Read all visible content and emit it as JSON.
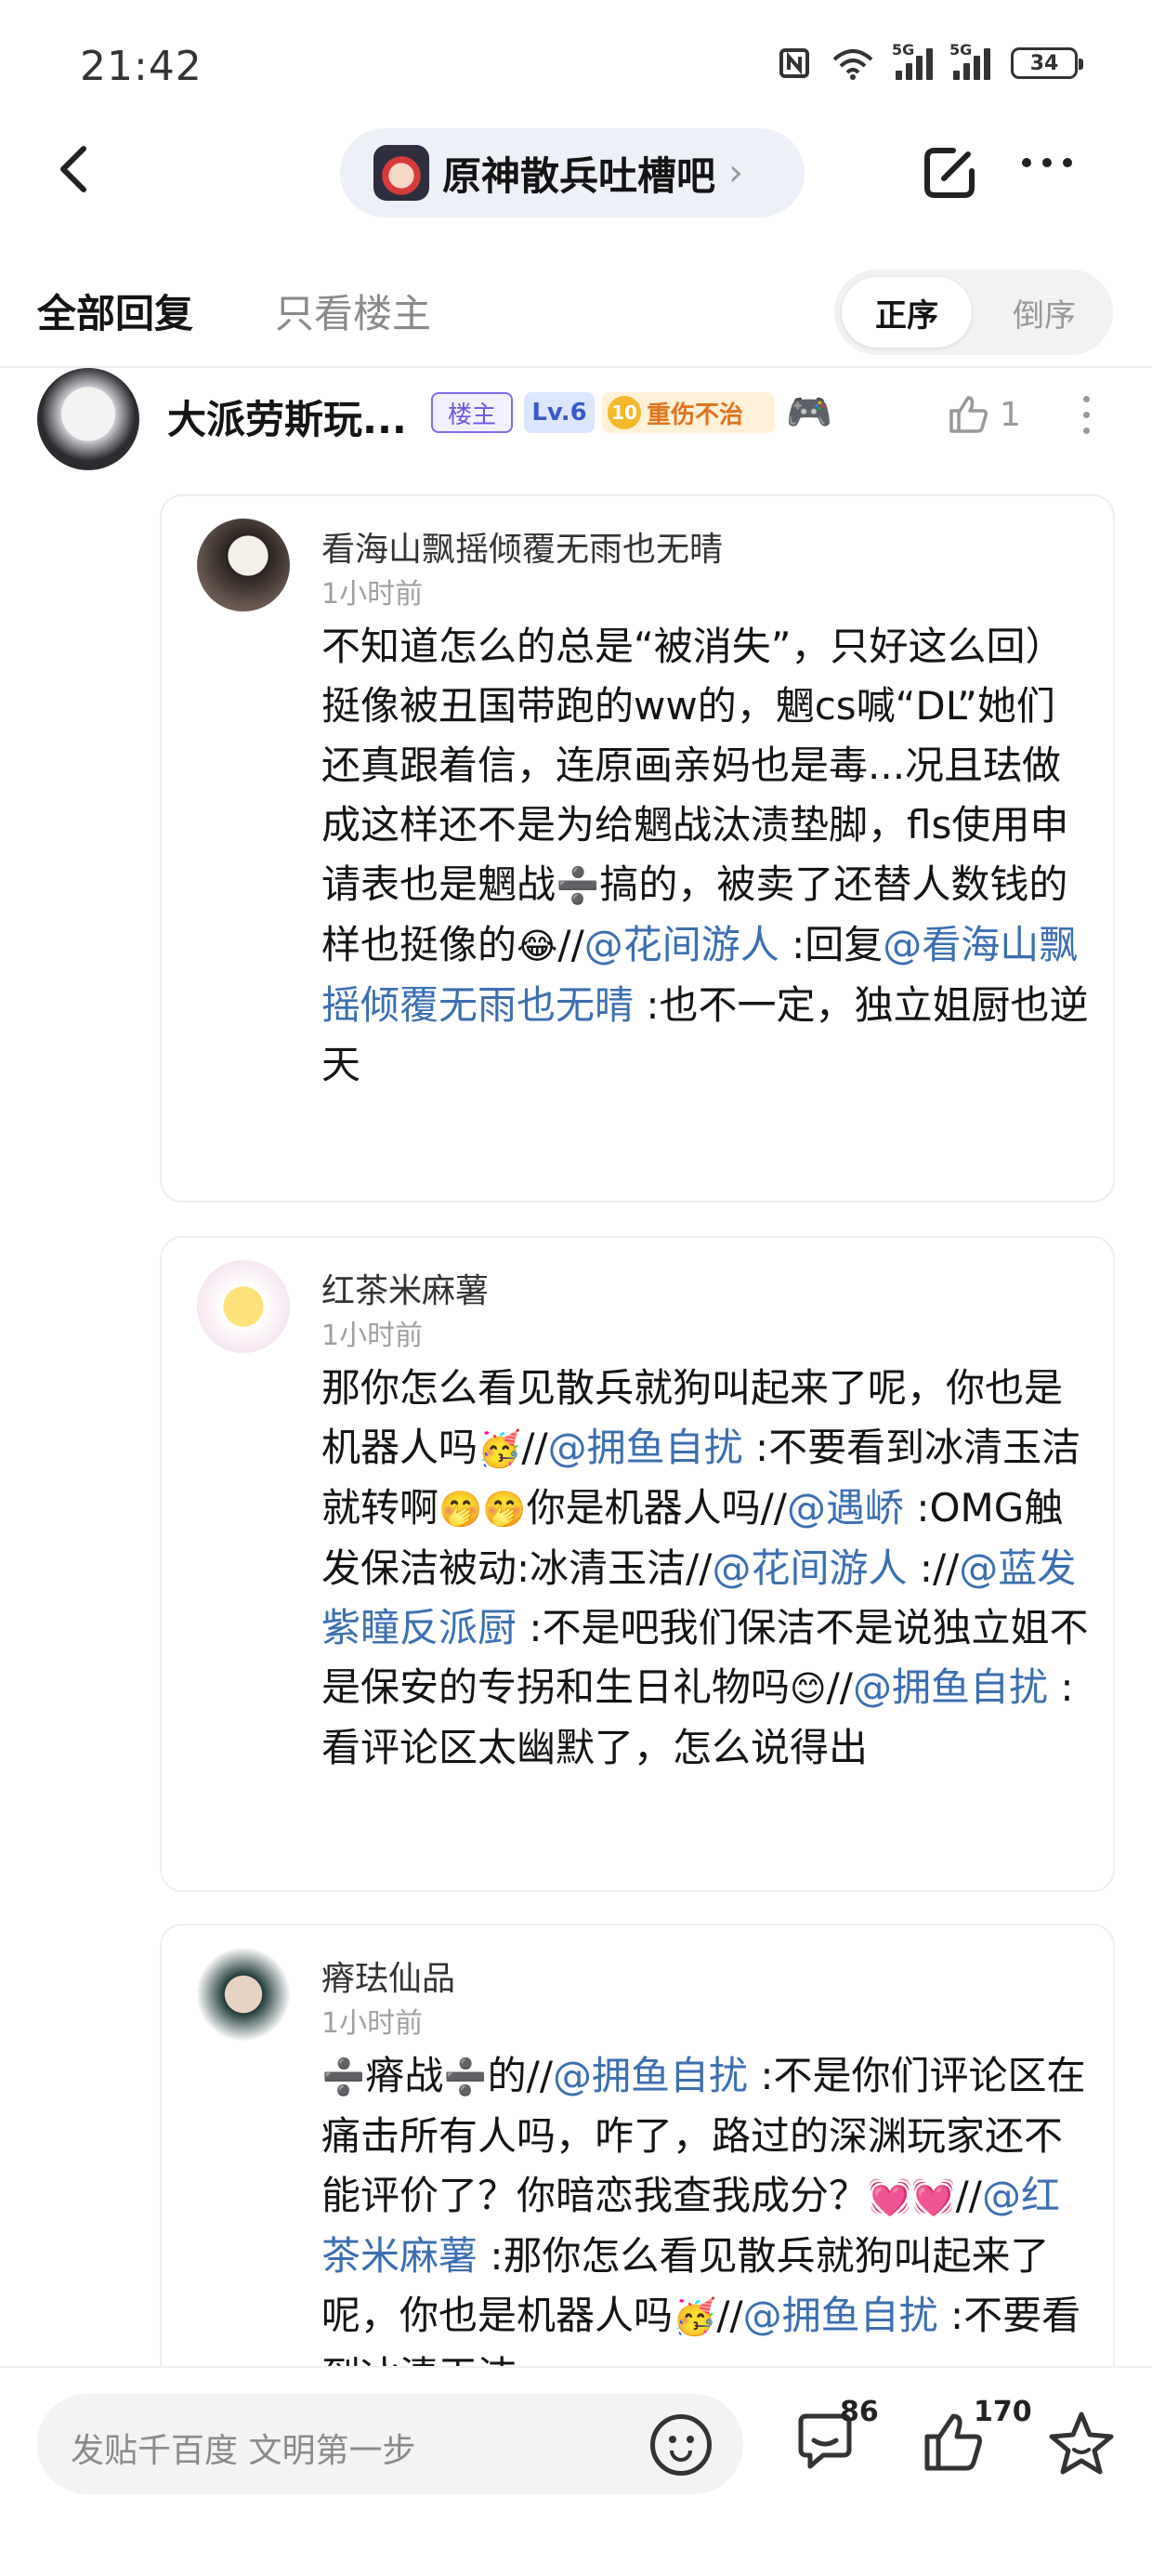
{
  "status_bar": {
    "time": "21:42",
    "network_a": "5G",
    "network_b": "5G",
    "battery": "34"
  },
  "nav": {
    "forum_name": "原神散兵吐槽吧",
    "chevron": "›"
  },
  "tabs": {
    "all_replies": "全部回复",
    "only_op": "只看楼主",
    "order_asc": "正序",
    "order_desc": "倒序"
  },
  "op": {
    "name": "大派劳斯玩...",
    "badge_host": "楼主",
    "badge_level": "Lv.6",
    "medal_number": "10",
    "badge_title": "重伤不治",
    "emoji": "🎮",
    "like_count": "1"
  },
  "comments": [
    {
      "name": "看海山飘摇倾覆无雨也无晴",
      "time": "1小时前",
      "segments": [
        {
          "t": "不知道怎么的总是“被消失”，只好这么回）挺像被丑国带跑的ww的，魍cs喊“DL”她们还真跟着信，连原画亲妈也是毒...况且珐做成这样还不是为给魍战汰渍垫脚，fls使用申请表也是魍战"
        },
        {
          "t": "➗",
          "emo": true
        },
        {
          "t": "搞的，被卖了还替人数钱的样也挺像的"
        },
        {
          "t": "😂",
          "emo": true
        },
        {
          "t": "//"
        },
        {
          "t": "@花间游人",
          "m": true
        },
        {
          "t": " :回复"
        },
        {
          "t": "@看海山飘摇倾覆无雨也无晴",
          "m": true
        },
        {
          "t": " :也不一定，独立姐厨也逆天"
        }
      ]
    },
    {
      "name": "红茶米麻薯",
      "time": "1小时前",
      "segments": [
        {
          "t": "那你怎么看见散兵就狗叫起来了呢，你也是机器人吗"
        },
        {
          "t": "🥳",
          "emo": true
        },
        {
          "t": "//"
        },
        {
          "t": "@拥鱼自扰",
          "m": true
        },
        {
          "t": " :不要看到冰清玉洁就转啊"
        },
        {
          "t": "🤭🤭",
          "emo": true
        },
        {
          "t": "你是机器人吗//"
        },
        {
          "t": "@遇峤",
          "m": true
        },
        {
          "t": " :OMG触发保洁被动:冰清玉洁//"
        },
        {
          "t": "@花间游人",
          "m": true
        },
        {
          "t": " ://"
        },
        {
          "t": "@蓝发紫瞳反派厨",
          "m": true
        },
        {
          "t": " :不是吧我们保洁不是说独立姐不是保安的专拐和生日礼物吗"
        },
        {
          "t": "😊",
          "emo": true
        },
        {
          "t": "//"
        },
        {
          "t": "@拥鱼自扰",
          "m": true
        },
        {
          "t": " :看评论区太幽默了，怎么说得出"
        }
      ]
    },
    {
      "name": "瘠珐仙品",
      "time": "1小时前",
      "segments": [
        {
          "t": "➗",
          "emo": true
        },
        {
          "t": "瘠战"
        },
        {
          "t": "➗",
          "emo": true
        },
        {
          "t": "的//"
        },
        {
          "t": "@拥鱼自扰",
          "m": true
        },
        {
          "t": " :不是你们评论区在痛击所有人吗，咋了，路过的深渊玩家还不能评价了？你暗恋我查我成分？"
        },
        {
          "t": "💓💓",
          "emo": true
        },
        {
          "t": "//"
        },
        {
          "t": "@红茶米麻薯",
          "m": true
        },
        {
          "t": " :那你怎么看见散兵就狗叫起来了呢，你也是机器人吗"
        },
        {
          "t": "🥳",
          "emo": true
        },
        {
          "t": "//"
        },
        {
          "t": "@拥鱼自扰",
          "m": true
        },
        {
          "t": " :不要看到冰清玉洁"
        }
      ]
    }
  ],
  "bottom_bar": {
    "reply_placeholder": "发贴千百度 文明第一步",
    "comment_count": "86",
    "like_count": "170"
  },
  "colors": {
    "mention": "#3b6fb0",
    "accent_host": "#6a5ae0",
    "title_badge": "#e0741a"
  },
  "icons": [
    "back-arrow-icon",
    "chevron-right-icon",
    "edit-icon",
    "more-icon",
    "emoji-icon",
    "comment-icon",
    "thumbs-up-icon",
    "star-icon",
    "wifi-icon",
    "nfc-icon",
    "signal-icon",
    "battery-icon"
  ]
}
